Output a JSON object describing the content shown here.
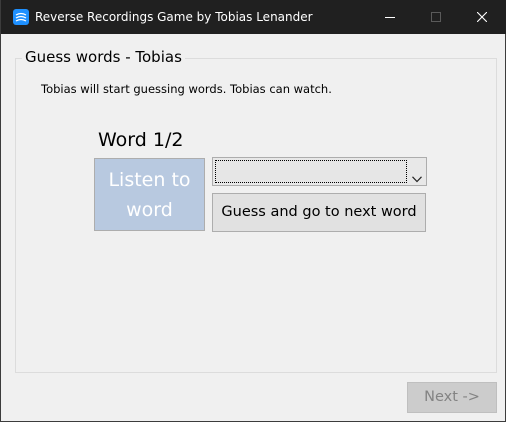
{
  "window": {
    "title": "Reverse Recordings Game by Tobias Lenander"
  },
  "group": {
    "title": "Guess words - Tobias",
    "info": "Tobias will start guessing words. Tobias can watch.",
    "word_counter": "Word 1/2",
    "listen_button": {
      "line1": "Listen to",
      "line2": "word",
      "enabled": false
    },
    "word_select": {
      "value": ""
    },
    "guess_button": {
      "label": "Guess and go to next word"
    }
  },
  "footer": {
    "next_button": {
      "label": "Next ->",
      "enabled": false
    }
  },
  "icons": {
    "app": "app-icon",
    "minimize": "minimize-icon",
    "maximize": "maximize-icon",
    "close": "close-icon",
    "dropdown": "chevron-down-icon"
  },
  "colors": {
    "titlebar": "#202020",
    "app_icon": "#1e90ff",
    "listen_button_disabled": "#b8c9e0",
    "next_button_disabled": "#cccccc"
  }
}
